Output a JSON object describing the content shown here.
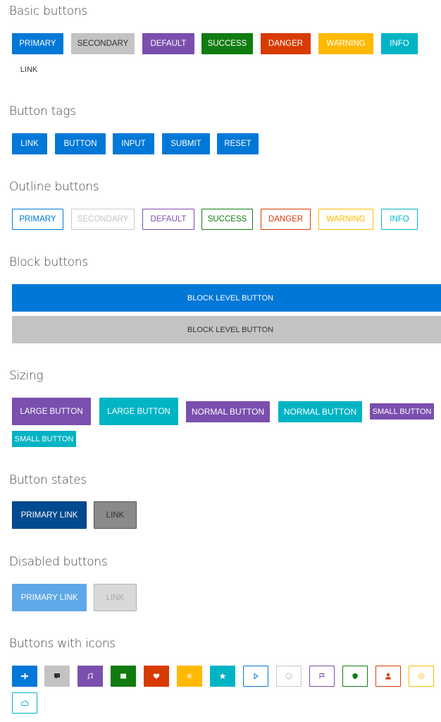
{
  "sections": {
    "basic": {
      "title": "Basic buttons",
      "buttons": [
        "PRIMARY",
        "SECONDARY",
        "DEFAULT",
        "SUCCESS",
        "DANGER",
        "WARNING",
        "INFO",
        "LINK"
      ]
    },
    "tags": {
      "title": "Button tags",
      "buttons": [
        "LINK",
        "BUTTON",
        "INPUT",
        "SUBMIT",
        "RESET"
      ]
    },
    "outline": {
      "title": "Outline buttons",
      "buttons": [
        "PRIMARY",
        "SECONDARY",
        "DEFAULT",
        "SUCCESS",
        "DANGER",
        "WARNING",
        "INFO"
      ]
    },
    "block": {
      "title": "Block buttons",
      "buttons": [
        "BLOCK LEVEL BUTTON",
        "BLOCK LEVEL BUTTON"
      ]
    },
    "sizing": {
      "title": "Sizing",
      "buttons": [
        "LARGE BUTTON",
        "LARGE BUTTON",
        "NORMAL BUTTON",
        "NORMAL BUTTON",
        "SMALL BUTTON",
        "SMALL BUTTON"
      ]
    },
    "states": {
      "title": "Button states",
      "buttons": [
        "PRIMARY LINK",
        "LINK"
      ]
    },
    "disabled": {
      "title": "Disabled buttons",
      "buttons": [
        "PRIMARY LINK",
        "LINK"
      ]
    },
    "icons": {
      "title": "Buttons with icons",
      "icons": [
        "plane",
        "message",
        "music",
        "calendar",
        "heart",
        "sun",
        "star",
        "play",
        "smile",
        "flag",
        "shield",
        "user",
        "support",
        "cloud"
      ]
    }
  },
  "colors": {
    "primary": "#0078d7",
    "secondary": "#c3c3c3",
    "default": "#7a4fad",
    "success": "#107c10",
    "danger": "#d83b01",
    "warning": "#ffb900",
    "info": "#00b4c4"
  }
}
